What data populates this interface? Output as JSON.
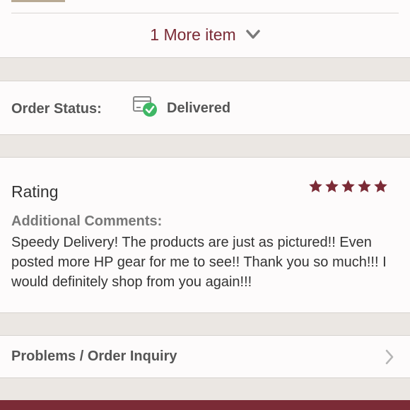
{
  "more_items": {
    "label": "1 More item",
    "icon": "chevron-down-icon"
  },
  "order_status": {
    "label": "Order Status:",
    "value": "Delivered",
    "icon": "package-delivered-icon",
    "status_color": "#3fb765"
  },
  "rating": {
    "label": "Rating",
    "stars": 5,
    "max_stars": 5,
    "star_color": "#7b2b36"
  },
  "comments": {
    "label": "Additional Comments:",
    "text": "Speedy Delivery! The products are just as pictured!! Even posted more HP gear for me to see!! Thank you so much!!! I would definitely shop from you again!!!"
  },
  "problems": {
    "label": "Problems / Order Inquiry",
    "icon": "chevron-right-icon"
  },
  "colors": {
    "accent": "#7b2b36",
    "background": "#ebe7e3",
    "card": "#fdfbfb"
  }
}
